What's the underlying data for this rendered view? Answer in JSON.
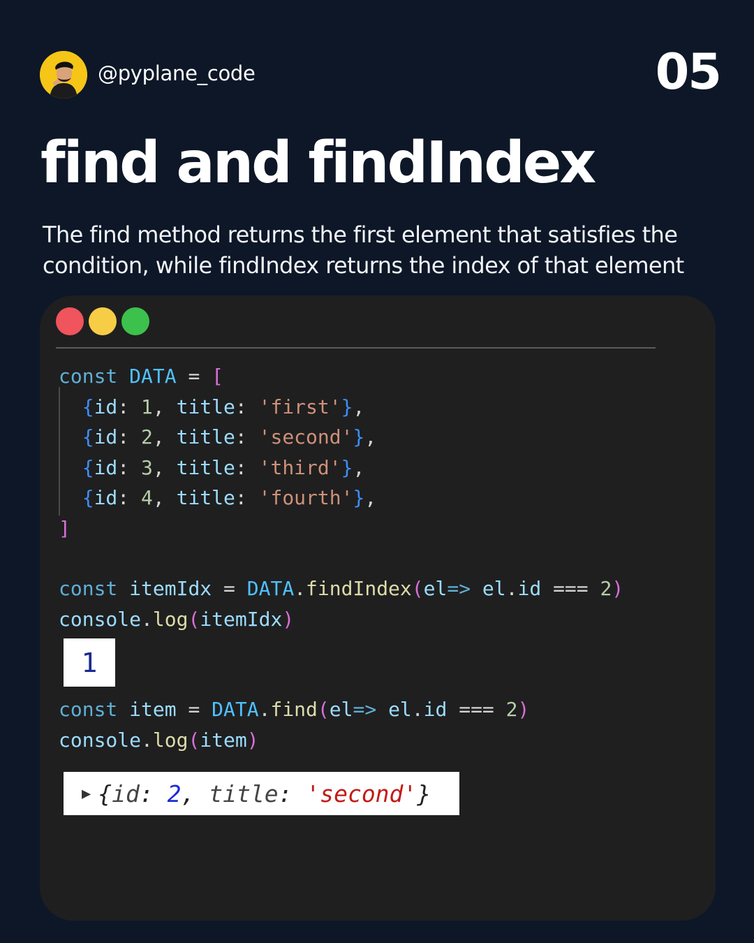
{
  "header": {
    "handle": "@pyplane_code",
    "slide_number": "05",
    "avatar_icon": "developer-avatar-icon"
  },
  "title": "find and findIndex",
  "description": "The find method returns the first element that satisfies the condition, while findIndex returns the index of that element",
  "editor": {
    "window_controls": [
      "close-dot",
      "minimize-dot",
      "maximize-dot"
    ],
    "colors": {
      "red": "#f0545c",
      "yellow": "#f7cd46",
      "green": "#3cc14c"
    },
    "block1": {
      "keyword": "const",
      "name": "DATA",
      "rows": [
        {
          "id": "1",
          "title": "'first'"
        },
        {
          "id": "2",
          "title": "'second'"
        },
        {
          "id": "3",
          "title": "'third'"
        },
        {
          "id": "4",
          "title": "'fourth'"
        }
      ]
    },
    "block2": {
      "var": "itemIdx",
      "method": "findIndex",
      "param": "el",
      "compare_value": "2",
      "log_fn": "console.log"
    },
    "output1": "1",
    "block3": {
      "var": "item",
      "method": "find",
      "param": "el",
      "compare_value": "2",
      "log_fn": "console.log"
    },
    "output2": {
      "id_label": "id",
      "id_value": "2",
      "title_label": "title",
      "title_value": "'second'"
    }
  }
}
